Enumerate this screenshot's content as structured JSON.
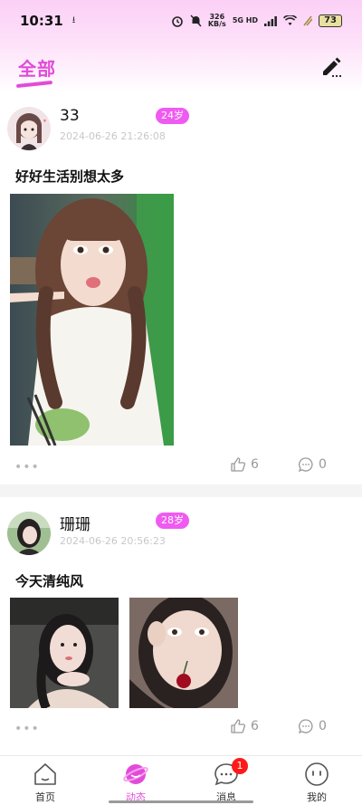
{
  "status_bar": {
    "time": "10:31",
    "download": "⭳",
    "net_speed": "326",
    "net_unit": "KB/s",
    "signal": "5G HD",
    "battery": "73"
  },
  "header": {
    "title": "全部"
  },
  "posts": [
    {
      "username": "33",
      "age": "24岁",
      "time": "2024-06-26 21:26:08",
      "text": "好好生活别想太多",
      "likes": "6",
      "comments": "0",
      "more": "•••"
    },
    {
      "username": "珊珊",
      "age": "28岁",
      "time": "2024-06-26 20:56:23",
      "text": "今天清纯风",
      "likes": "6",
      "comments": "0",
      "more": "•••"
    }
  ],
  "tabs": [
    {
      "label": "首页",
      "icon": "house-icon"
    },
    {
      "label": "动态",
      "icon": "planet-icon"
    },
    {
      "label": "消息",
      "icon": "chat-bubble-icon",
      "badge": "1"
    },
    {
      "label": "我的",
      "icon": "smiley-icon"
    }
  ],
  "colors": {
    "accent": "#e24bd9",
    "age_badge": "#ef5bf0",
    "notification": "#ff1a1a"
  }
}
